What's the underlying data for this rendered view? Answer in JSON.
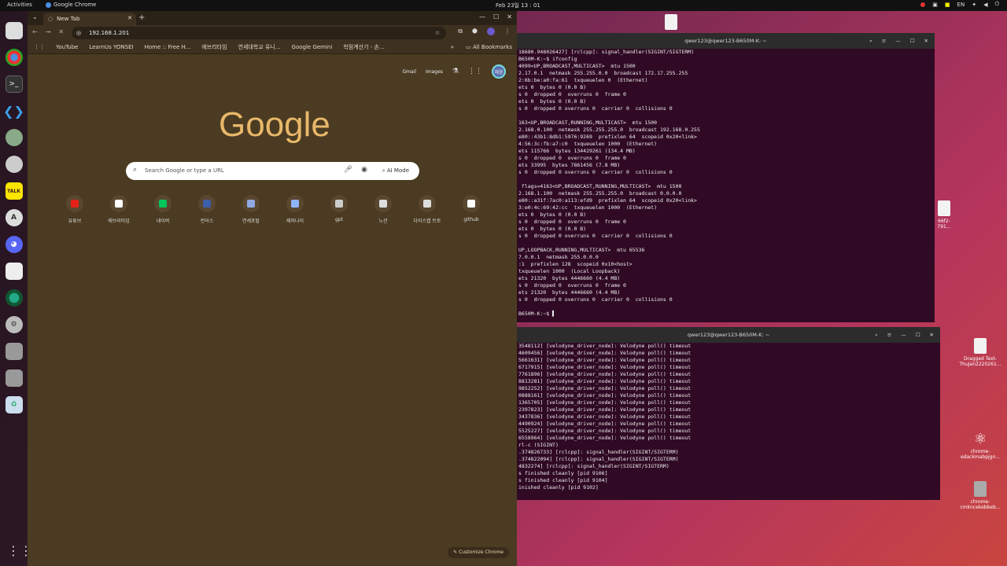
{
  "topbar": {
    "activities": "Activities",
    "app_name": "Google Chrome",
    "clock": "Feb 23일 13 : 01",
    "lang": "EN"
  },
  "chrome": {
    "tab_title": "New Tab",
    "url": "192.168.1.201",
    "bookmarks": [
      "YouTube",
      "LearnUs YONSEI",
      "Home :: Free H...",
      "에브리타임",
      "연세대학교 유니...",
      "Google Gemini",
      "학점계산기 - 손..."
    ],
    "all_bookmarks": "All Bookmarks",
    "gmail": "Gmail",
    "images": "Images",
    "avatar": "해웅",
    "logo": "Google",
    "search_placeholder": "Search Google or type a URL",
    "ai_mode": "AI Mode",
    "shortcuts": [
      {
        "label": "유튜브",
        "color": "#e62117"
      },
      {
        "label": "에브리타임",
        "color": "#ffffff"
      },
      {
        "label": "네이버",
        "color": "#03c75a"
      },
      {
        "label": "런어스",
        "color": "#3b5fa8"
      },
      {
        "label": "연세포탈",
        "color": "#8fa8e0"
      },
      {
        "label": "제미나이",
        "color": "#8fb4ff"
      },
      {
        "label": "gpt",
        "color": "#cccccc"
      },
      {
        "label": "노션",
        "color": "#dddddd"
      },
      {
        "label": "다이스랩 트토",
        "color": "#dddddd"
      },
      {
        "label": "github",
        "color": "#ffffff"
      }
    ],
    "customize": "Customize Chrome"
  },
  "term1": {
    "title": "qwer123@qwer123-B650M-K: ~",
    "lines": [
      "18680.948026427] [rclcpp]: signal_handler(SIGINT/SIGTERM)",
      "B650M-K:~$ ifconfig",
      "4099<UP,BROADCAST,MULTICAST>  mtu 1500",
      "2.17.0.1  netmask 255.255.0.0  broadcast 172.17.255.255",
      "2:6b:be:a0:fa:61  txqueuelen 0  (Ethernet)",
      "ets 0  bytes 0 (0.0 B)",
      "s 0  dropped 0  overruns 0  frame 0",
      "ets 0  bytes 0 (0.0 B)",
      "s 0  dropped 0 overruns 0  carrier 0  collisions 0",
      "",
      "163<UP,BROADCAST,RUNNING,MULTICAST>  mtu 1500",
      "2.168.0.100  netmask 255.255.255.0  broadcast 192.168.0.255",
      "e80::43b1:8db1:5976:9269  prefixlen 64  scopeid 0x20<link>",
      "4:56:3c:fb:a7:c0  txqueuelen 1000  (Ethernet)",
      "ets 115766  bytes 134429261 (134.4 MB)",
      "s 0  dropped 0  overruns 0  frame 0",
      "ets 33995  bytes 7861456 (7.8 MB)",
      "s 0  dropped 0 overruns 0  carrier 0  collisions 0",
      "",
      " flags=4163<UP,BROADCAST,RUNNING,MULTICAST>  mtu 1500",
      "2.168.1.100  netmask 255.255.255.0  broadcast 0.0.0.0",
      "e80::a31f:7ac0:a113:efd9  prefixlen 64  scopeid 0x20<link>",
      "3:e0:4c:69:42:cc  txqueuelen 1000  (Ethernet)",
      "ets 0  bytes 0 (0.0 B)",
      "s 0  dropped 0  overruns 0  frame 0",
      "ets 0  bytes 0 (0.0 B)",
      "s 0  dropped 0 overruns 0  carrier 0  collisions 0",
      "",
      "UP,LOOPBACK,RUNNING,MULTICAST>  mtu 65536",
      "7.0.0.1  netmask 255.0.0.0",
      ":1  prefixlen 128  scopeid 0x10<host>",
      "txqueuelen 1000  (Local Loopback)",
      "ets 21320  bytes 4446660 (4.4 MB)",
      "s 0  dropped 0  overruns 0  frame 0",
      "ets 21320  bytes 4446660 (4.4 MB)",
      "s 0  dropped 0 overruns 0  carrier 0  collisions 0",
      "",
      "B650M-K:~$ "
    ]
  },
  "term2": {
    "title": "qwer123@qwer123-B650M-K: ~",
    "lines": [
      "3548112] [velodyne_driver_node]: Velodyne poll() timeout",
      "4609456] [velodyne_driver_node]: Velodyne poll() timeout",
      "5661631] [velodyne_driver_node]: Velodyne poll() timeout",
      "6717915] [velodyne_driver_node]: Velodyne poll() timeout",
      "7761896] [velodyne_driver_node]: Velodyne poll() timeout",
      "8813281] [velodyne_driver_node]: Velodyne poll() timeout",
      "9852252] [velodyne_driver_node]: Velodyne poll() timeout",
      "0888161] [velodyne_driver_node]: Velodyne poll() timeout",
      "1365705] [velodyne_driver_node]: Velodyne poll() timeout",
      "2397823] [velodyne_driver_node]: Velodyne poll() timeout",
      "3437836] [velodyne_driver_node]: Velodyne poll() timeout",
      "4490924] [velodyne_driver_node]: Velodyne poll() timeout",
      "5525227] [velodyne_driver_node]: Velodyne poll() timeout",
      "6558964] [velodyne_driver_node]: Velodyne poll() timeout",
      "rl-c (SIGINT)",
      ".374826733] [rclcpp]: signal_handler(SIGINT/SIGTERM)",
      ".374822094] [rclcpp]: signal_handler(SIGINT/SIGTERM)",
      "4832274] [rclcpp]: signal_handler(SIGINT/SIGTERM)",
      "s finished cleanly [pid 9106]",
      "s finished cleanly [pid 9104]",
      "inished cleanly [pid 9102]"
    ]
  },
  "desktop": [
    {
      "label": "66f2-\n791..."
    },
    {
      "label": "Dragged Text-\nThuJan2220261..."
    },
    {
      "label": "chrome-\nedackmabpjgn..."
    },
    {
      "label": "chrome-\ncmkncekebbeb..."
    }
  ],
  "colors": {
    "chrome_bg": "#4b3b22",
    "terminal_bg": "#300a24",
    "logo": "#e8b86a"
  }
}
